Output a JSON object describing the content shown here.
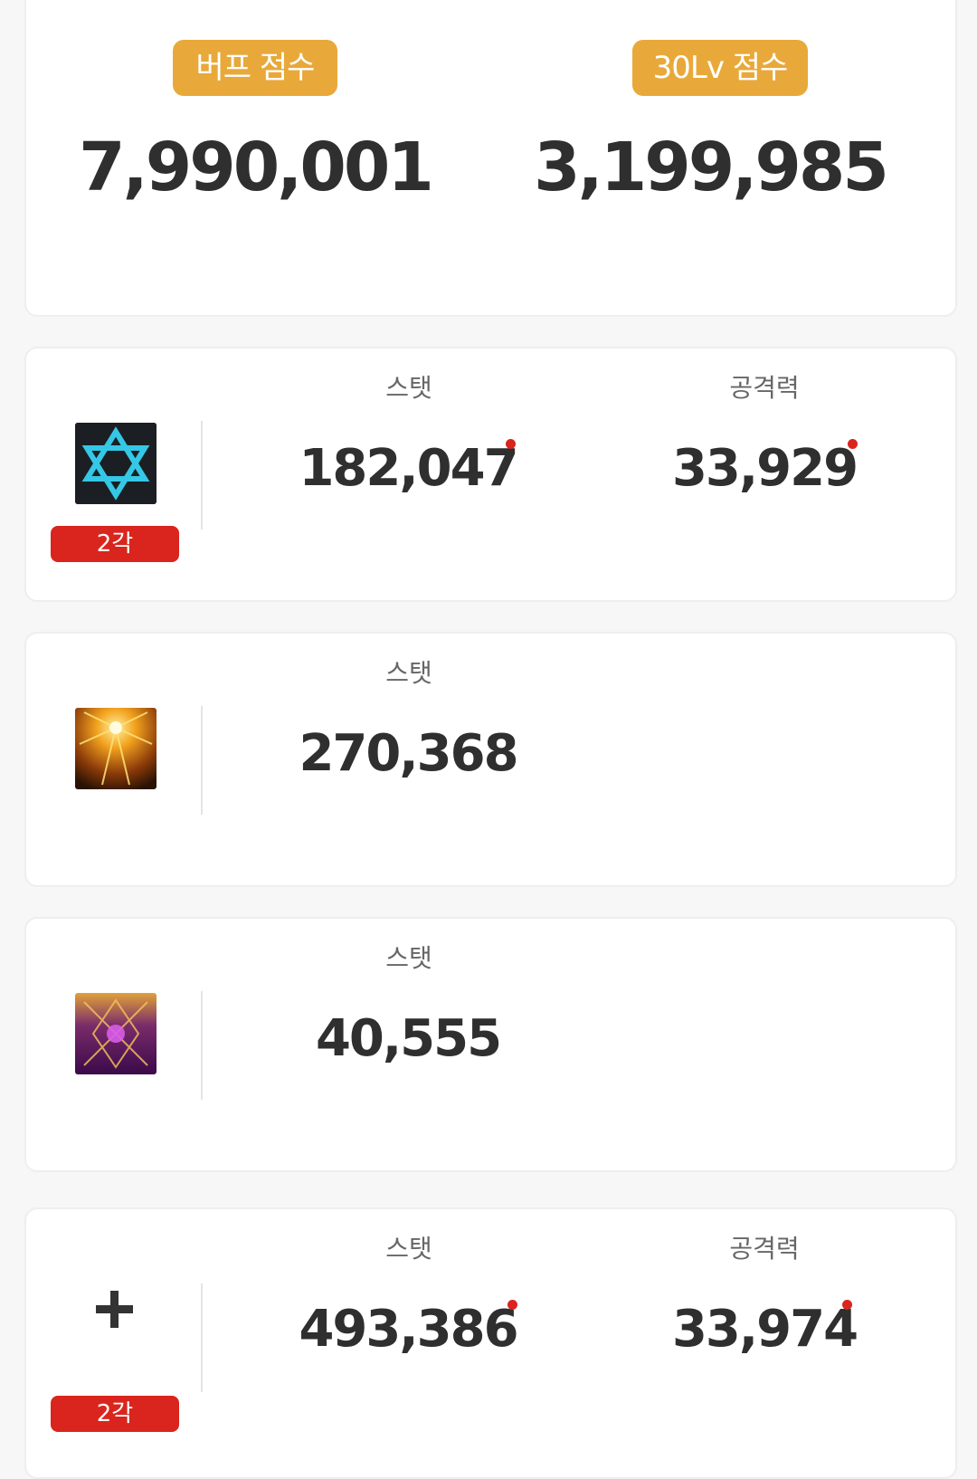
{
  "summary": {
    "buff_label": "버프 점수",
    "buff_value": "7,990,001",
    "lv30_label": "30Lv 점수",
    "lv30_value": "3,199,985"
  },
  "rows": [
    {
      "icon": "hexagram-icon",
      "badge": "2각",
      "stat_label": "스탯",
      "stat_value": "182,047",
      "attack_label": "공격력",
      "attack_value": "33,929"
    },
    {
      "icon": "golden-burst-icon",
      "stat_label": "스탯",
      "stat_value": "270,368"
    },
    {
      "icon": "purple-crystal-icon",
      "stat_label": "스탯",
      "stat_value": "40,555"
    },
    {
      "icon": "plus-icon",
      "badge": "2각",
      "stat_label": "스탯",
      "stat_value": "493,386",
      "attack_label": "공격력",
      "attack_value": "33,974"
    }
  ],
  "colors": {
    "pill": "#e8a93a",
    "badge": "#d9251d",
    "dot": "#d9251d",
    "text": "#2f2f2f"
  }
}
